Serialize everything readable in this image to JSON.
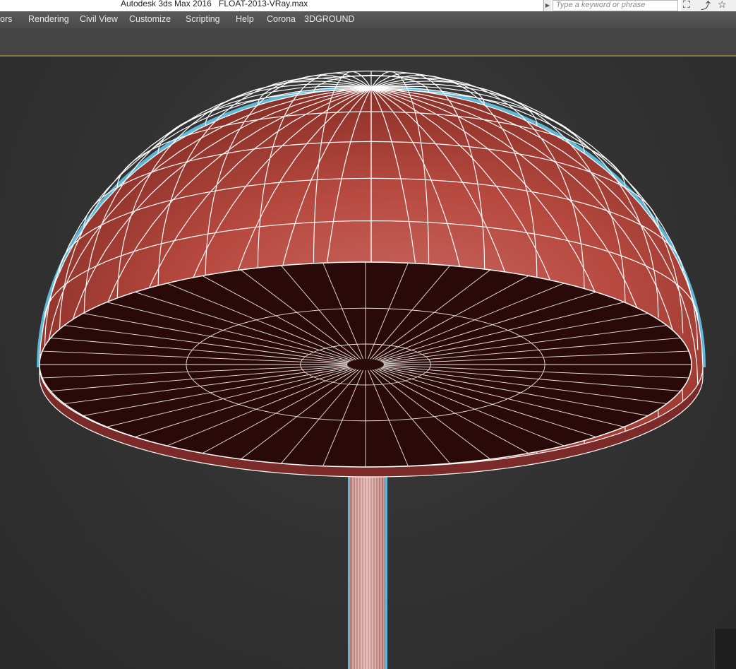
{
  "titlebar": {
    "app_title": "Autodesk 3ds Max 2016",
    "file_title": "FLOAT-2013-VRay.max",
    "search_placeholder": "Type a keyword or phrase",
    "icons": [
      "binoculars-icon",
      "sign-in-icon",
      "star-icon"
    ]
  },
  "menubar": {
    "items": [
      "ors",
      "Rendering",
      "Civil View",
      "Customize",
      "Scripting",
      "Help",
      "Corona",
      "3DGROUND"
    ]
  },
  "viewport": {
    "object": "mushroom-lamp-wireframe",
    "colors": {
      "shade_top": "#c0504a",
      "shade_edge": "#7a2a28",
      "underside": "#2a0a08",
      "wire": "#ffffff",
      "selection_outline": "#5fb8d8",
      "background": "#333333"
    }
  }
}
